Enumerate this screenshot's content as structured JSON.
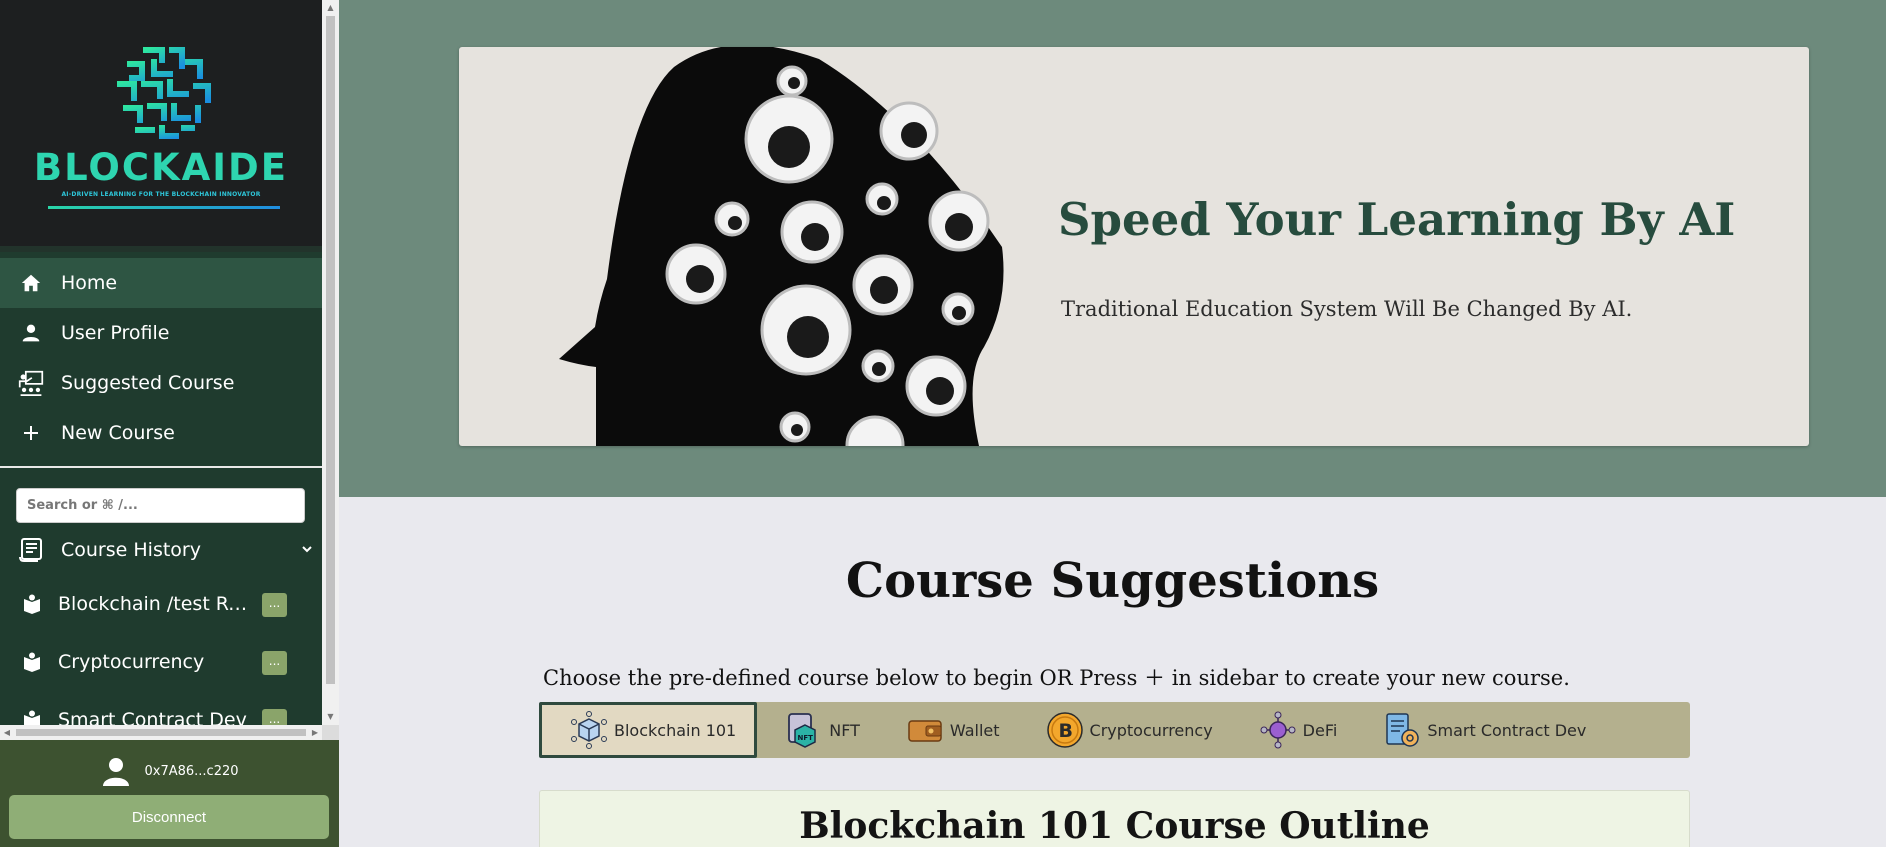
{
  "app": {
    "logo_text": "BLOCKAIDE",
    "logo_tagline": "AI-DRIVEN LEARNING FOR THE BLOCKCHAIN INNOVATOR"
  },
  "sidebar": {
    "nav": [
      {
        "label": "Home",
        "icon": "home-icon",
        "active": true
      },
      {
        "label": "User Profile",
        "icon": "user-icon"
      },
      {
        "label": "Suggested Course",
        "icon": "teacher-icon"
      },
      {
        "label": "New Course",
        "icon": "plus-icon"
      }
    ],
    "search_placeholder": "Search or ⌘ /...",
    "history_label": "Course History",
    "history": [
      {
        "label": "Blockchain /test Re...",
        "more": "..."
      },
      {
        "label": "Cryptocurrency",
        "more": "..."
      },
      {
        "label": "Smart Contract Dev",
        "more": "..."
      }
    ],
    "account_address": "0x7A86...c220",
    "disconnect_label": "Disconnect"
  },
  "hero": {
    "title": "Speed Your Learning By AI",
    "subtitle": "Traditional Education System Will Be Changed By AI."
  },
  "suggestions": {
    "title": "Course Suggestions",
    "description": "Choose the pre-defined course below to begin OR Press ＋ in sidebar to create your new course.",
    "tabs": [
      {
        "label": "Blockchain 101",
        "icon": "blockchain-cube-icon",
        "active": true
      },
      {
        "label": "NFT",
        "icon": "nft-icon"
      },
      {
        "label": "Wallet",
        "icon": "wallet-icon"
      },
      {
        "label": "Cryptocurrency",
        "icon": "bitcoin-icon"
      },
      {
        "label": "DeFi",
        "icon": "defi-icon"
      },
      {
        "label": "Smart Contract Dev",
        "icon": "smart-contract-icon"
      }
    ],
    "outline_title": "Blockchain 101 Course Outline"
  },
  "colors": {
    "sidebar_bg": "#1f3b2e",
    "nav_active": "#2e5543",
    "hero_bg": "#6d8a7c",
    "hero_title": "#274c3e",
    "tabs_bg": "#b4b08e",
    "account_bg": "#3d5230",
    "disconnect_bg": "#8fae76"
  }
}
